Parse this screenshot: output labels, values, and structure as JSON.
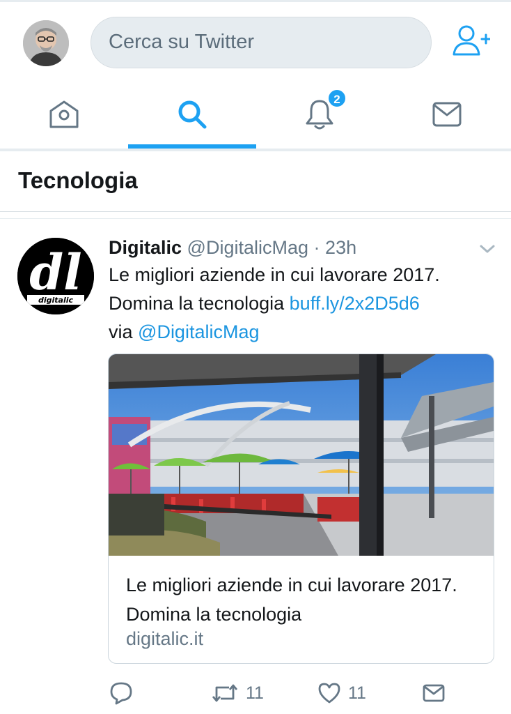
{
  "search": {
    "placeholder": "Cerca su Twitter"
  },
  "nav": {
    "tabs": [
      {
        "icon": "home-icon"
      },
      {
        "icon": "search-icon",
        "active": true
      },
      {
        "icon": "notifications-icon",
        "badge": "2"
      },
      {
        "icon": "messages-icon"
      }
    ],
    "accent_color": "#1da1f2"
  },
  "section": {
    "title": "Tecnologia"
  },
  "tweet": {
    "author_name": "Digitalic",
    "handle": "@DigitalicMag",
    "separator": "·",
    "time": "23h",
    "text_line1": "Le migliori aziende in cui lavorare 2017.",
    "text_line2": "Domina la tecnologia ",
    "link": "buff.ly/2x2D5d6",
    "via": "via ",
    "mention": "@DigitalicMag",
    "avatar_logo": {
      "letters": "dl",
      "caption": "digitalic"
    },
    "card": {
      "title": "Le migliori aziende in cui lavorare 2017. Domina la tecnologia",
      "domain": "digitalic.it"
    },
    "actions": {
      "reply_icon": "reply-icon",
      "retweet_count": "11",
      "like_count": "11",
      "share_icon": "share-icon"
    }
  },
  "colors": {
    "link": "#1b95e0",
    "secondary_text": "#657786",
    "divider": "#e6ecf0"
  }
}
